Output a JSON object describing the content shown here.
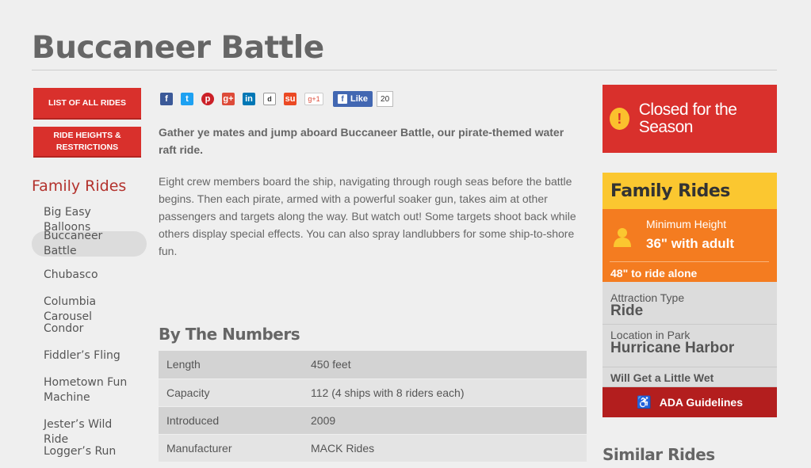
{
  "page": {
    "title": "Buccaneer Battle"
  },
  "nav_buttons": {
    "list_all": "LIST OF ALL RIDES",
    "heights": "RIDE HEIGHTS & RESTRICTIONS"
  },
  "sidebar": {
    "title": "Family Rides",
    "items": [
      {
        "label": "Big Easy Balloons"
      },
      {
        "label": "Buccaneer Battle",
        "active": true
      },
      {
        "label": "Chubasco"
      },
      {
        "label": "Columbia Carousel"
      },
      {
        "label": "Condor"
      },
      {
        "label": "Fiddler’s Fling"
      },
      {
        "label": "Hometown Fun Machine"
      },
      {
        "label": "Jester’s Wild Ride"
      },
      {
        "label": "Logger’s Run"
      }
    ]
  },
  "share": {
    "icons": [
      "facebook-icon",
      "twitter-icon",
      "pinterest-icon",
      "google-plus-icon",
      "linkedin-icon",
      "digg-icon",
      "stumbleupon-icon",
      "google-plusone-icon"
    ],
    "gplus_label": "g+1",
    "like_label": "Like",
    "like_count": "20"
  },
  "content": {
    "intro": "Gather ye mates and jump aboard Buccaneer Battle, our pirate-themed water raft ride.",
    "body": "Eight crew members board the ship, navigating through rough seas before the battle begins. Then each pirate, armed with a powerful soaker gun, takes aim at other passengers and targets along the way. But watch out! Some targets shoot back while others display special effects. You can also spray landlubbers for some ship-to-shore fun."
  },
  "numbers": {
    "title": "By The Numbers",
    "rows": [
      {
        "key": "Length",
        "value": "450 feet"
      },
      {
        "key": "Capacity",
        "value": "112 (4 ships with 8 riders each)"
      },
      {
        "key": "Introduced",
        "value": "2009"
      },
      {
        "key": "Manufacturer",
        "value": "MACK Rides"
      }
    ]
  },
  "status": {
    "text": "Closed for the Season",
    "icon": "warning-icon"
  },
  "ride_info": {
    "category": "Family Rides",
    "min_height_label": "Minimum Height",
    "min_height_value": "36\" with adult",
    "alone_text": "48\" to ride alone",
    "type_label": "Attraction Type",
    "type_value": "Ride",
    "location_label": "Location in Park",
    "location_value": "Hurricane Harbor",
    "wet_text": "Will Get a Little Wet",
    "ada_label": "ADA Guidelines"
  },
  "similar": {
    "title": "Similar Rides"
  },
  "colors": {
    "brand_red": "#d9302c",
    "yellow": "#fbc730",
    "orange": "#f47c20",
    "dark_red": "#b31e1e"
  }
}
